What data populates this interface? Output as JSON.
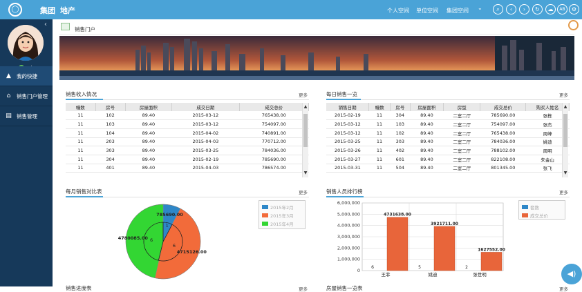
{
  "topbar": {
    "brand": "集团",
    "brand2": "地产",
    "links": [
      "个人空间",
      "单位空间",
      "集团空间"
    ],
    "group_caret": "⌄",
    "icons": [
      "search-icon",
      "back-icon",
      "forward-icon",
      "refresh-icon",
      "cloud-icon",
      "ab-icon",
      "settings-icon"
    ],
    "ab_label": "AB"
  },
  "sidebar": {
    "user_count": "3人",
    "collapse_glyph": "‹",
    "items": [
      {
        "label": "我的快捷",
        "icon": "warning-icon"
      },
      {
        "label": "销售门户管理",
        "icon": "home-icon"
      },
      {
        "label": "销售管理",
        "icon": "document-icon"
      }
    ]
  },
  "page": {
    "title": "销售门户"
  },
  "panel_income": {
    "title": "销售收入情况",
    "more": "更多",
    "headers": [
      "幢数",
      "房号",
      "房屋面积",
      "成交日期",
      "成交总价"
    ],
    "rows": [
      [
        "11",
        "102",
        "89.40",
        "2015-03-12",
        "765438.00"
      ],
      [
        "11",
        "103",
        "89.40",
        "2015-03-12",
        "754097.00"
      ],
      [
        "11",
        "104",
        "89.40",
        "2015-04-02",
        "740891.00"
      ],
      [
        "11",
        "203",
        "89.40",
        "2015-04-03",
        "770712.00"
      ],
      [
        "11",
        "303",
        "89.40",
        "2015-03-25",
        "784036.00"
      ],
      [
        "11",
        "304",
        "89.40",
        "2015-02-19",
        "785690.00"
      ],
      [
        "11",
        "401",
        "89.40",
        "2015-04-03",
        "786574.00"
      ]
    ]
  },
  "panel_daily": {
    "title": "每日销售一览",
    "more": "更多",
    "headers": [
      "销售日期",
      "幢数",
      "房号",
      "房屋面积",
      "房型",
      "成交总价",
      "购买人姓名"
    ],
    "rows": [
      [
        "2015-02-19",
        "11",
        "304",
        "89.40",
        "二室二厅",
        "785690.00",
        "张栋"
      ],
      [
        "2015-03-12",
        "11",
        "103",
        "89.40",
        "二室二厅",
        "754097.00",
        "张杰"
      ],
      [
        "2015-03-12",
        "11",
        "102",
        "89.40",
        "二室二厅",
        "765438.00",
        "周峰"
      ],
      [
        "2015-03-25",
        "11",
        "303",
        "89.40",
        "二室二厅",
        "784036.00",
        "姚迪"
      ],
      [
        "2015-03-26",
        "11",
        "402",
        "89.40",
        "二室二厅",
        "788102.00",
        "周明"
      ],
      [
        "2015-03-27",
        "11",
        "601",
        "89.40",
        "二室二厅",
        "822108.00",
        "朱金山"
      ],
      [
        "2015-03-31",
        "11",
        "504",
        "89.40",
        "二室二厅",
        "801345.00",
        "张飞"
      ]
    ]
  },
  "panel_monthly": {
    "title": "每月销售对比表",
    "more": "更多"
  },
  "panel_rank": {
    "title": "销售人员排行榜",
    "more": "更多"
  },
  "panel_bottom_left": {
    "title": "销售进度表",
    "more": "更多"
  },
  "panel_bottom_right": {
    "title": "房屋销售一览表",
    "more": "更多"
  },
  "chart_data": [
    {
      "type": "pie",
      "labels": [
        "2015年2月",
        "2015年3月",
        "2015年4月"
      ],
      "colors": [
        "#2e87c8",
        "#f26b3a",
        "#33d633"
      ],
      "outer_values": [
        785690.0,
        4715126.0,
        4780085.0
      ],
      "outer_labels": [
        "785690.00",
        "4715126.00",
        "4780085.00"
      ],
      "inner_values": [
        1,
        6,
        6
      ],
      "inner_labels": [
        "1",
        "6",
        "6"
      ],
      "legend_position": "right"
    },
    {
      "type": "bar",
      "categories": [
        "王菲",
        "姚迪",
        "张世明"
      ],
      "series": [
        {
          "name": "套数",
          "color": "#2e87c8",
          "values": [
            6,
            5,
            2
          ],
          "labels": [
            "6",
            "5",
            "2"
          ]
        },
        {
          "name": "成交总价",
          "color": "#e8653a",
          "values": [
            4731638.0,
            3921711.0,
            1627552.0
          ],
          "labels": [
            "4731638.00",
            "3921711.00",
            "1627552.00"
          ]
        }
      ],
      "ylim": [
        0,
        6000000
      ],
      "yticks": [
        "0",
        "1,000,000",
        "2,000,000",
        "3,000,000",
        "4,000,000",
        "5,000,000",
        "6,000,000"
      ],
      "grid": true,
      "legend_position": "right"
    }
  ]
}
